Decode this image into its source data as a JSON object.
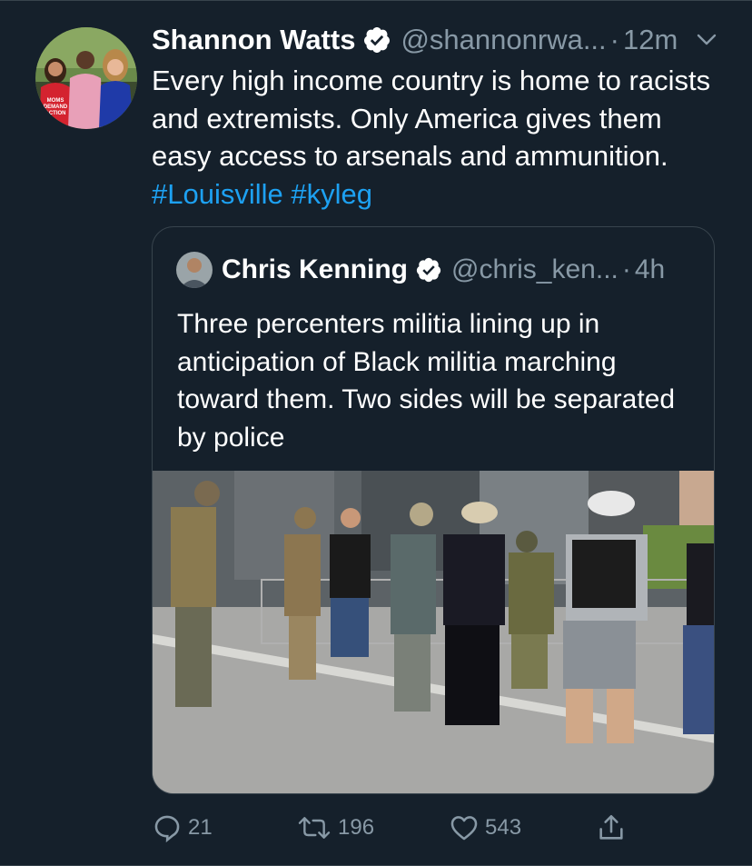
{
  "tweet": {
    "author_name": "Shannon Watts",
    "handle": "@shannonrwa...",
    "separator": "·",
    "time": "12m",
    "text_main": "Every high income country is home to racists and extremists. Only America gives them easy access to arsenals and ammunition.",
    "hashtags": [
      "#Louisville",
      "#kyleg"
    ],
    "avatar_text": [
      "MOMS",
      "DEMAND",
      "ACTION"
    ]
  },
  "quoted": {
    "author_name": "Chris Kenning",
    "handle": "@chris_ken...",
    "separator": "·",
    "time": "4h",
    "text": "Three percenters militia lining up in anticipation of Black militia marching toward them. Two sides will be separated by police"
  },
  "actions": {
    "reply_count": "21",
    "retweet_count": "196",
    "like_count": "543"
  },
  "colors": {
    "background": "#15202b",
    "link": "#1da1f2",
    "muted": "#8899a6",
    "border": "#38444d"
  },
  "icons": [
    "verified-badge-icon",
    "chevron-down-icon",
    "reply-icon",
    "retweet-icon",
    "like-icon",
    "share-icon"
  ]
}
